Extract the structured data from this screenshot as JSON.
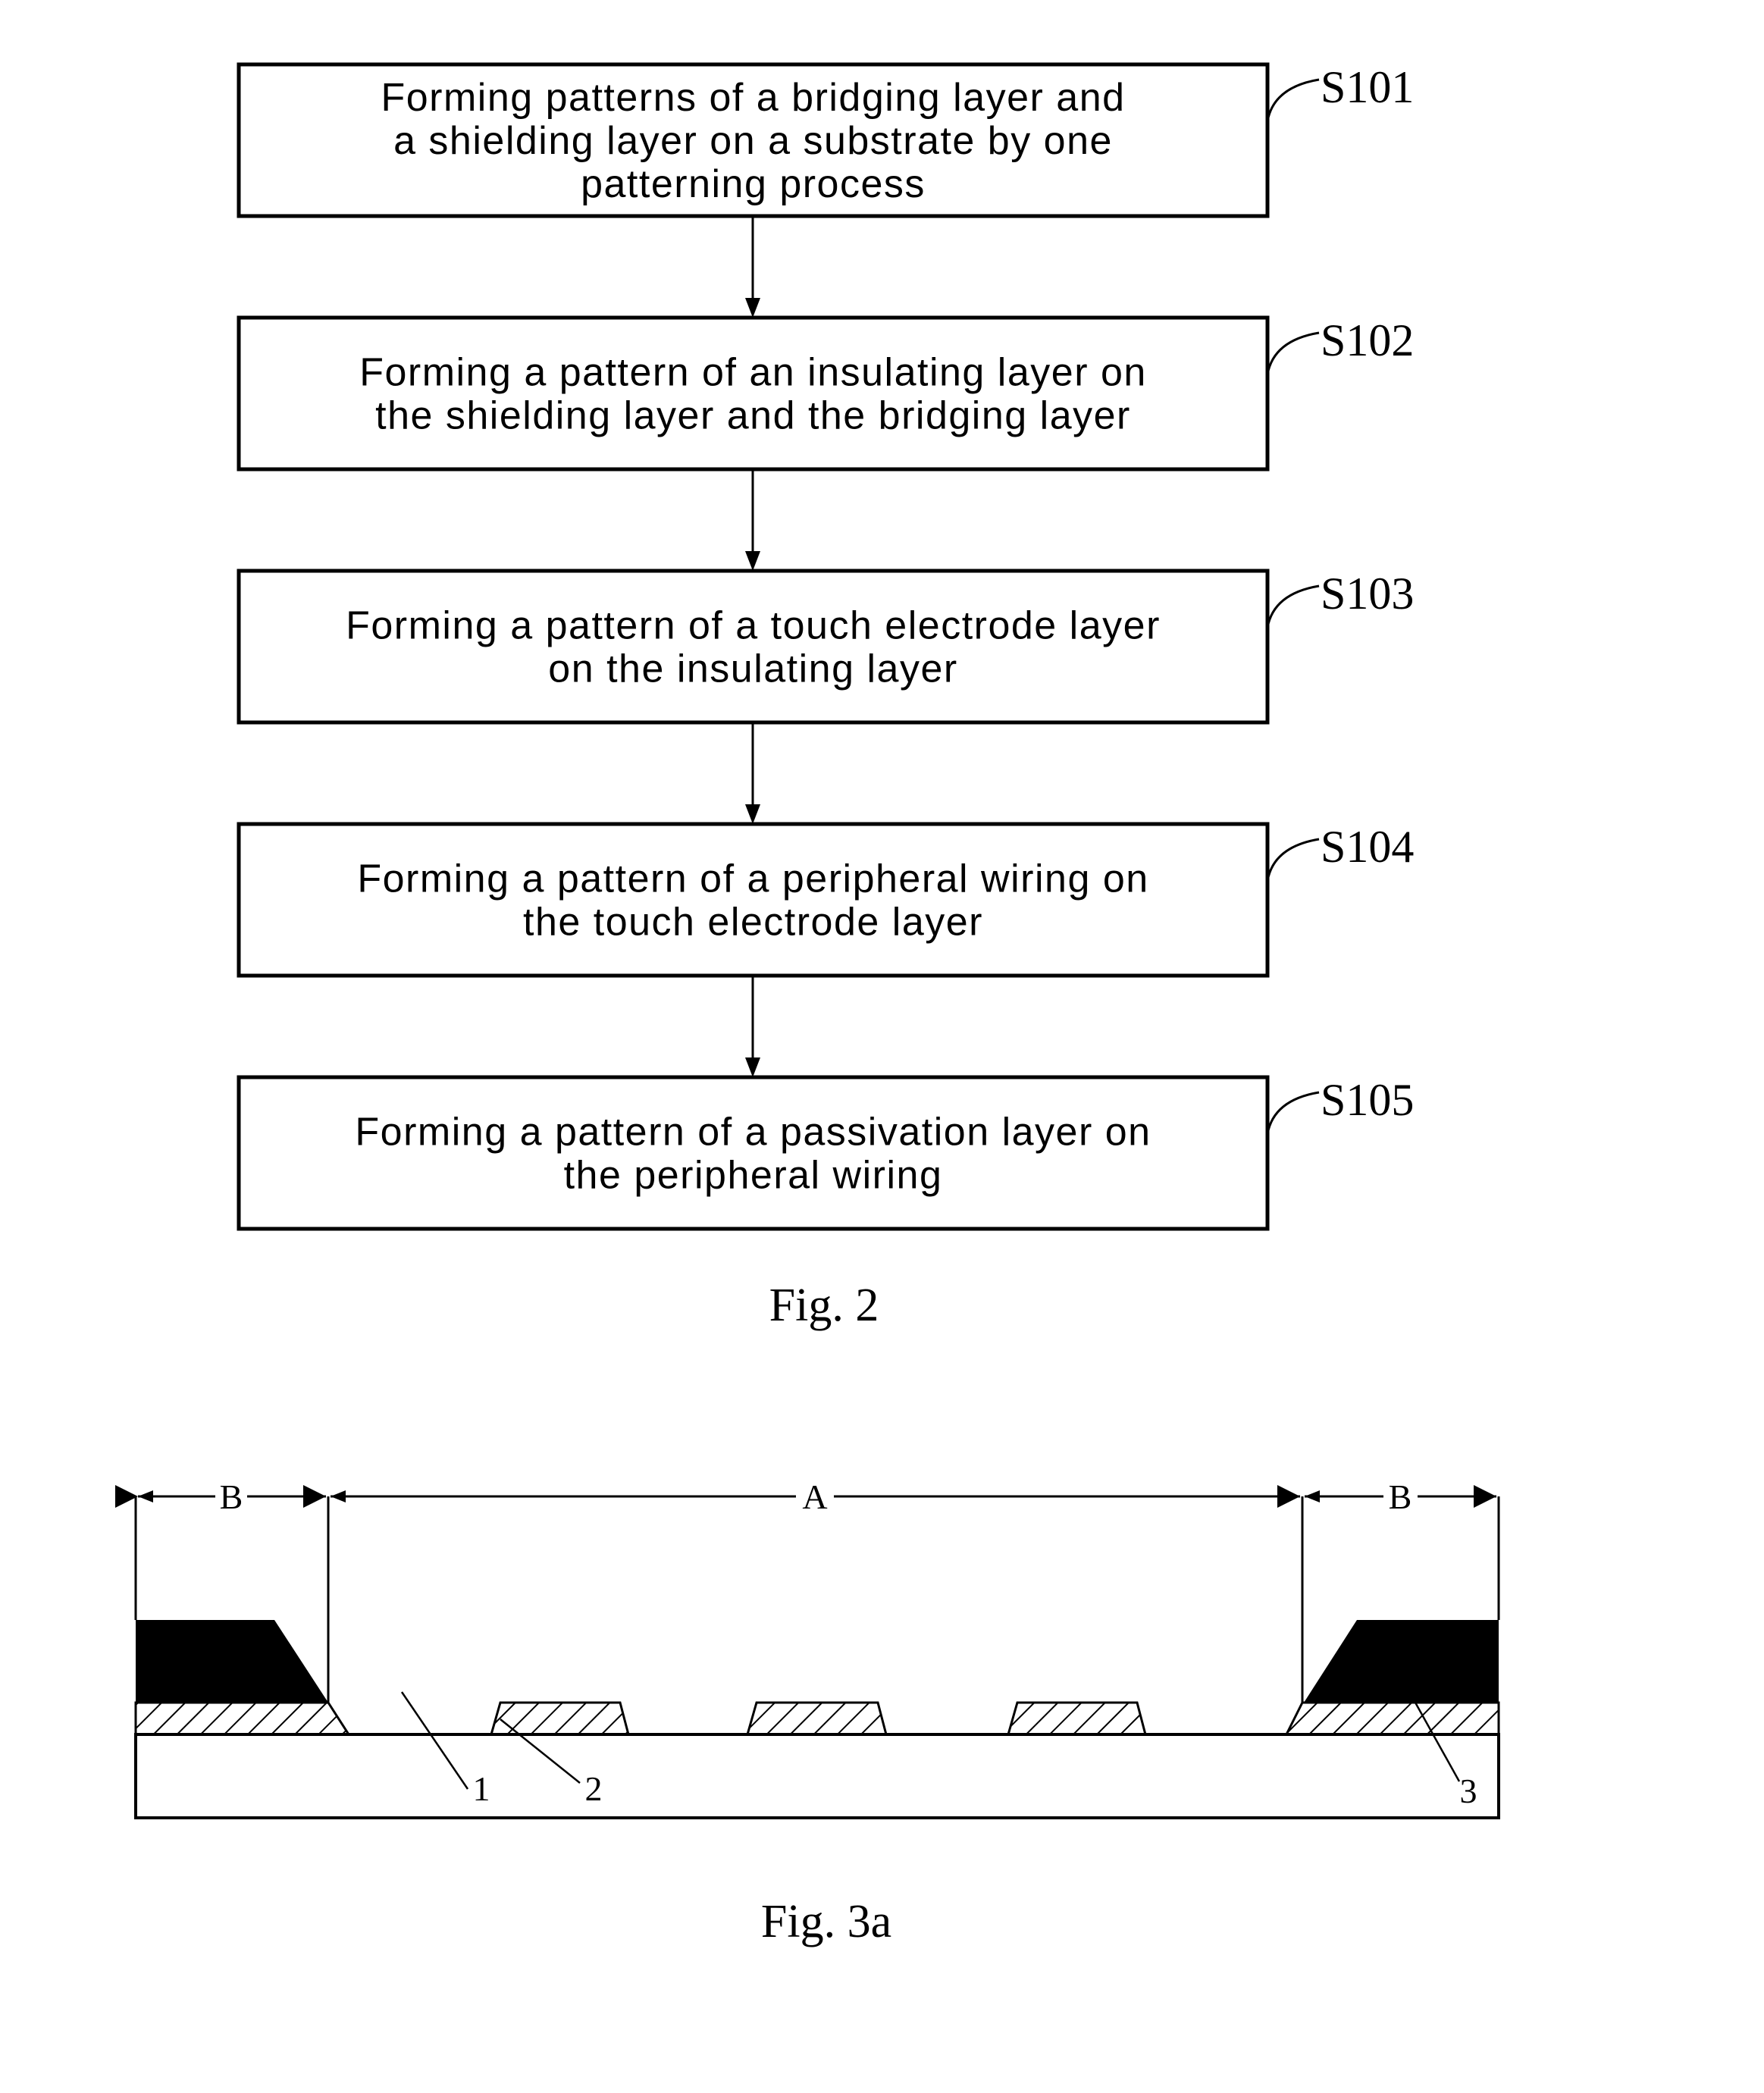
{
  "figure2": {
    "caption": "Fig. 2",
    "steps": [
      {
        "id": "S101",
        "lines": [
          "Forming patterns of a bridging layer and",
          "a shielding layer on a substrate by one",
          "patterning process"
        ]
      },
      {
        "id": "S102",
        "lines": [
          "Forming a pattern of an insulating layer on",
          "the shielding layer and the bridging layer"
        ]
      },
      {
        "id": "S103",
        "lines": [
          "Forming a pattern of a touch electrode layer",
          "on the insulating layer"
        ]
      },
      {
        "id": "S104",
        "lines": [
          "Forming a pattern of a peripheral wiring on",
          "the touch electrode layer"
        ]
      },
      {
        "id": "S105",
        "lines": [
          "Forming a pattern of a passivation layer on",
          "the peripheral wiring"
        ]
      }
    ]
  },
  "figure3a": {
    "caption": "Fig. 3a",
    "regions": {
      "left": "B",
      "center": "A",
      "right": "B"
    },
    "references": {
      "substrate": "1",
      "bridging_layer": "2",
      "shielding_layer": "3"
    },
    "bridge_count": 3
  }
}
